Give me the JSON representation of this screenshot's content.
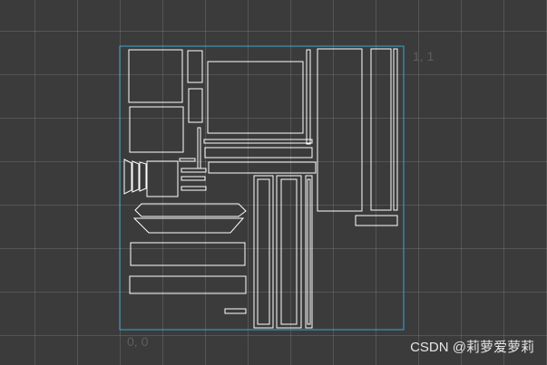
{
  "viewport": {
    "corner_label_top_right": "1, 1",
    "corner_label_bottom_left": "0, 0"
  },
  "colors": {
    "background": "#3b3b3b",
    "grid_line": "#575757",
    "uv_bounds": "#3aa6d6",
    "uv_island_stroke": "#ffffff",
    "label": "#5e5e5e"
  },
  "watermark": {
    "text": "CSDN @莉萝爱萝莉"
  }
}
